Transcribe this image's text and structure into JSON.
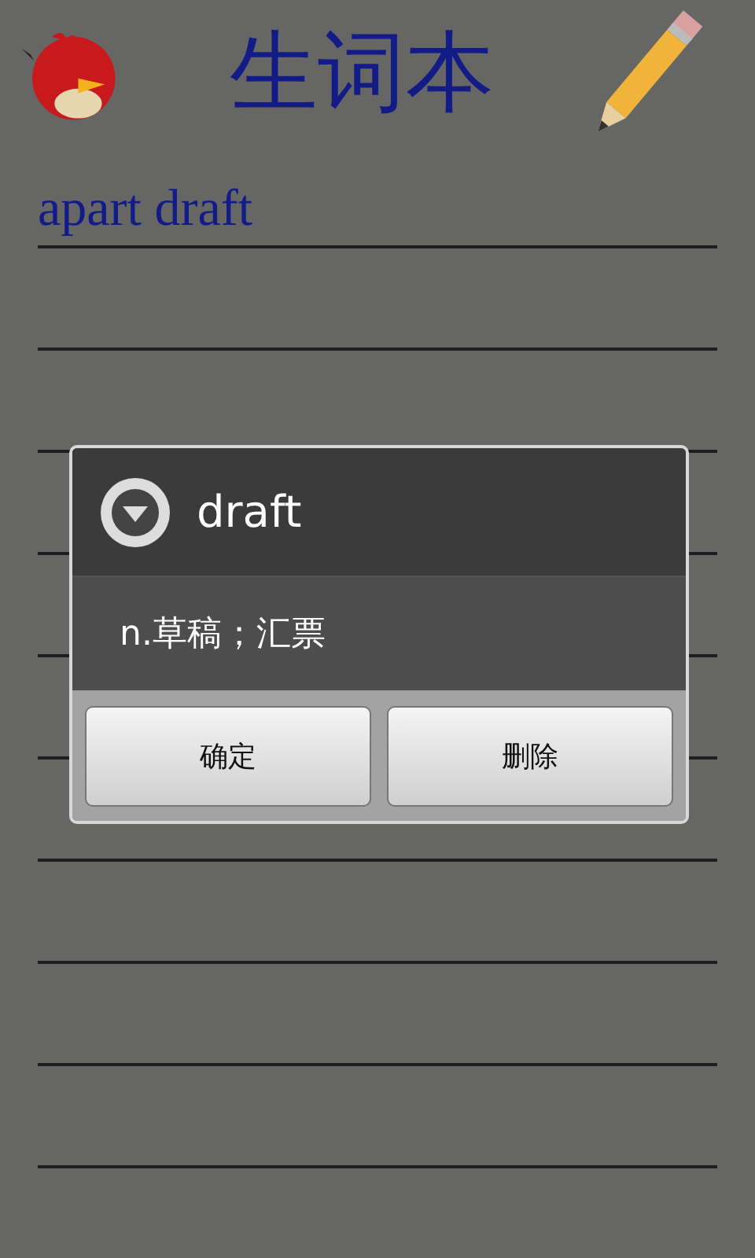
{
  "header": {
    "title": "生词本"
  },
  "notebook": {
    "text": "apart draft"
  },
  "dialog": {
    "title": "draft",
    "definition": "n.草稿；汇票",
    "buttons": [
      "确定",
      "删除"
    ]
  }
}
